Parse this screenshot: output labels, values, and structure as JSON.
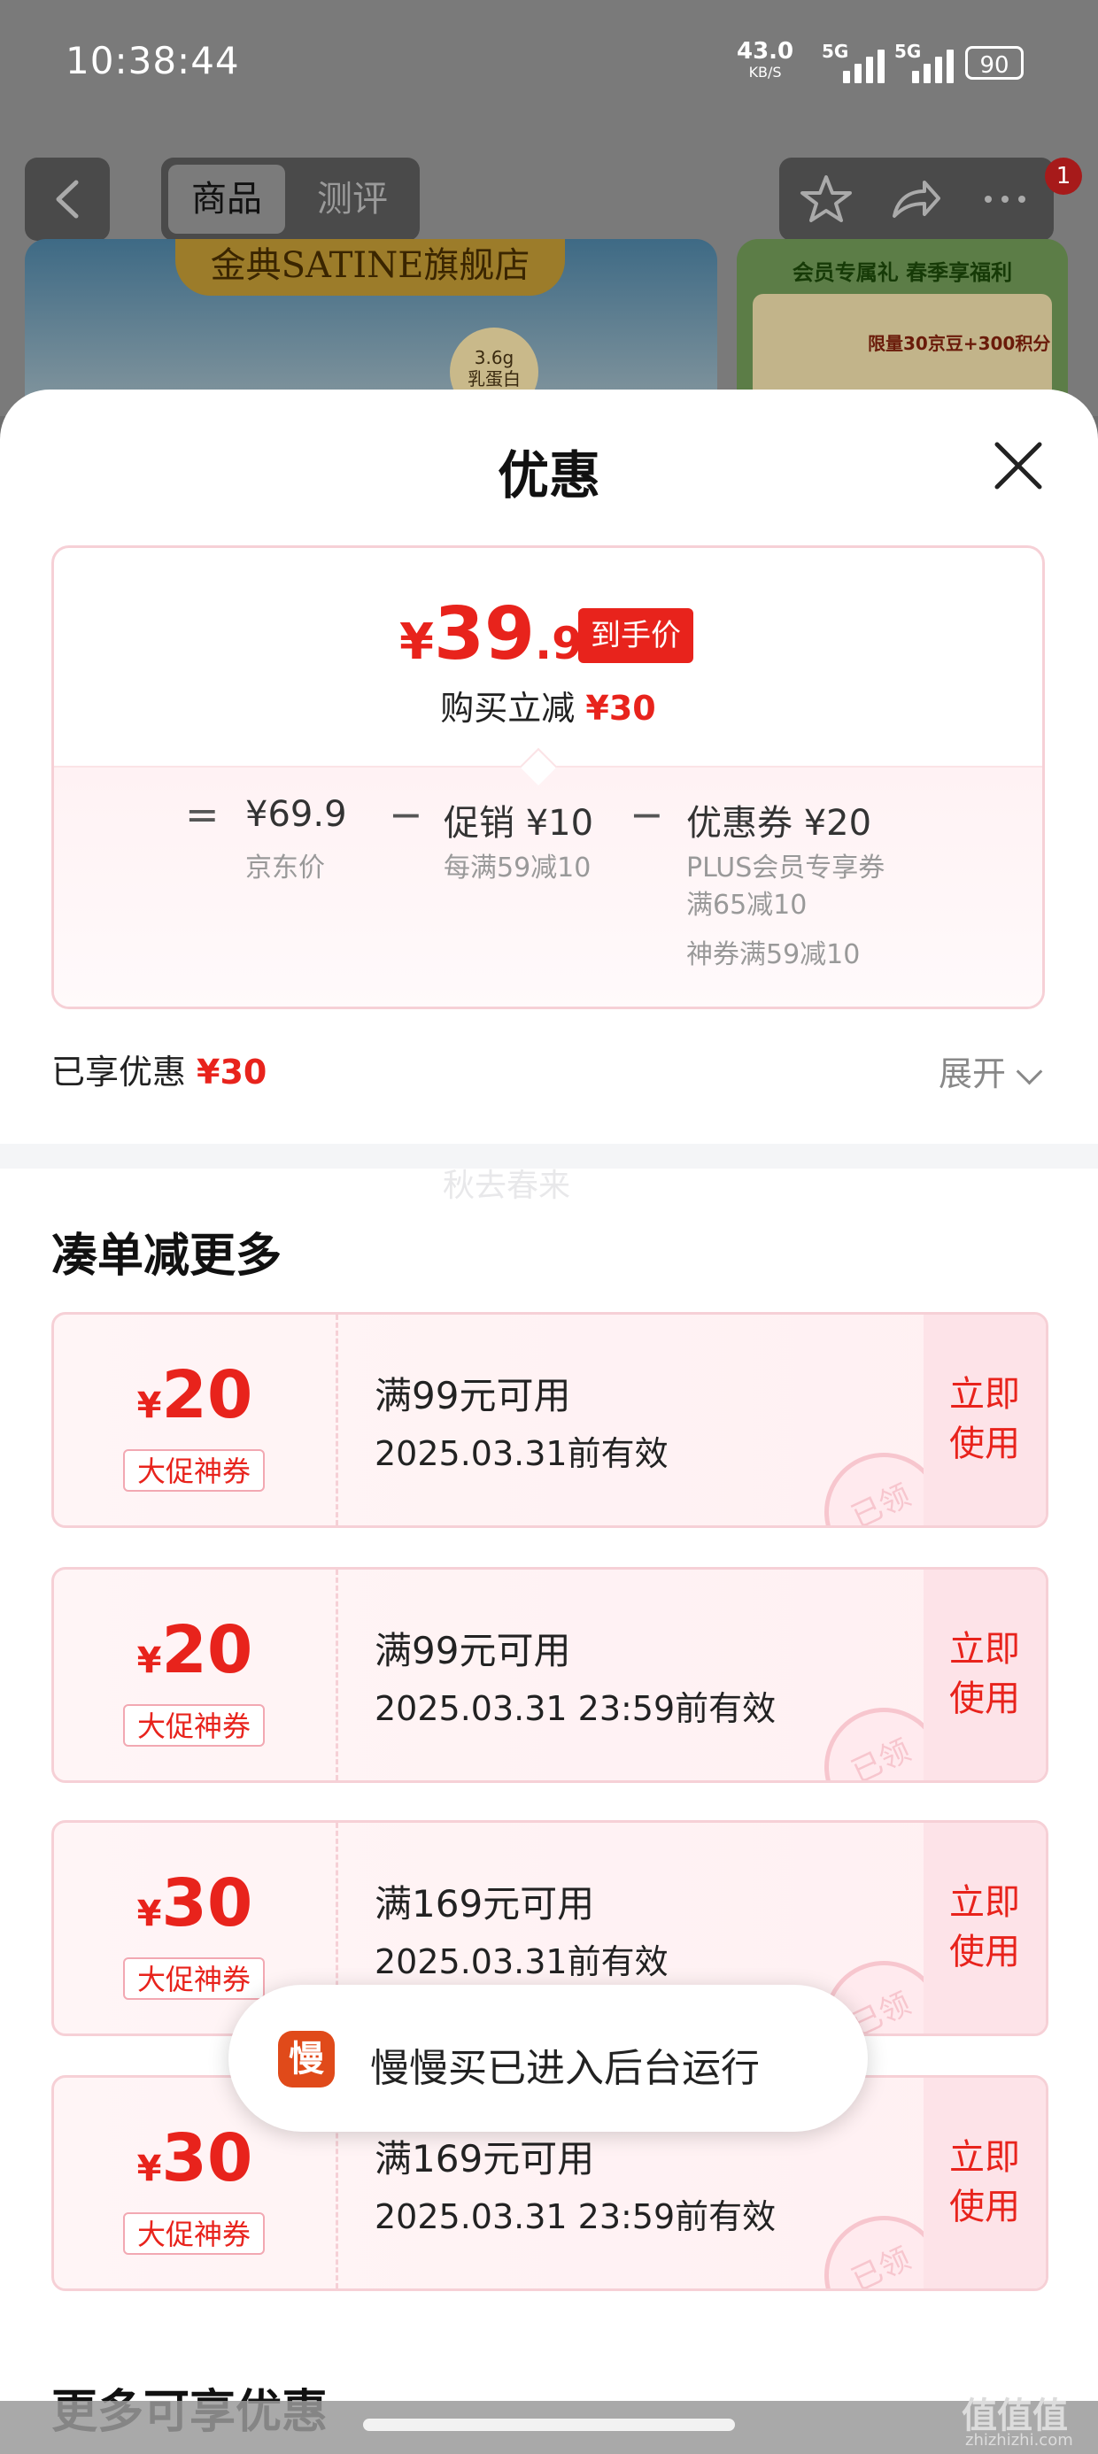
{
  "status": {
    "time": "10:38:44",
    "net_speed": "43.0",
    "net_unit": "KB/S",
    "sig1": "5G",
    "sig2": "5G",
    "battery": "90"
  },
  "nav": {
    "tab_product": "商品",
    "tab_review": "测评",
    "notification_count": "1"
  },
  "banner": {
    "store_name": "金典SATINE旗舰店",
    "badge": "3.6g\n乳蛋白",
    "promo_title": "会员专属礼 春季享福利",
    "promo_text": "限量30京豆+300积分"
  },
  "sheet": {
    "title": "优惠",
    "final_price_symbol": "¥",
    "final_price_int": "39",
    "final_price_dec": ".9",
    "final_price_tag": "到手价",
    "instant_label": "购买立减",
    "instant_value": "¥30",
    "breakdown": {
      "eq": "=",
      "minus": "−",
      "jd_price": "¥69.9",
      "jd_label": "京东价",
      "promo_value": "促销 ¥10",
      "promo_label": "每满59减10",
      "coupon_value": "优惠券 ¥20",
      "coupon_label1": "PLUS会员专享券",
      "coupon_label2": "满65减10",
      "coupon_label3": "神券满59减10"
    },
    "enjoyed_label": "已享优惠",
    "enjoyed_value": "¥30",
    "expand_label": "展开",
    "watermark": "秋去春来",
    "section_title": "凑单减更多",
    "coupons": [
      {
        "symbol": "¥",
        "amount": "20",
        "type": "大促神券",
        "condition": "满99元可用",
        "valid": "2025.03.31前有效",
        "use": "立即\n使用",
        "stamp": "已领"
      },
      {
        "symbol": "¥",
        "amount": "20",
        "type": "大促神券",
        "condition": "满99元可用",
        "valid": "2025.03.31 23:59前有效",
        "use": "立即\n使用",
        "stamp": "已领"
      },
      {
        "symbol": "¥",
        "amount": "30",
        "type": "大促神券",
        "condition": "满169元可用",
        "valid": "2025.03.31前有效",
        "use": "立即\n使用",
        "stamp": "已领"
      },
      {
        "symbol": "¥",
        "amount": "30",
        "type": "大促神券",
        "condition": "满169元可用",
        "valid": "2025.03.31 23:59前有效",
        "use": "立即\n使用",
        "stamp": "已领"
      }
    ],
    "more_title": "更多可享优惠"
  },
  "toast": {
    "icon_char": "慢",
    "text": "慢慢买已进入后台运行"
  },
  "site_watermark": {
    "logo": "值值值",
    "url": "zhizhizhi.com"
  },
  "colors": {
    "accent_red": "#e8231c",
    "coupon_border": "#f6d0d6"
  }
}
